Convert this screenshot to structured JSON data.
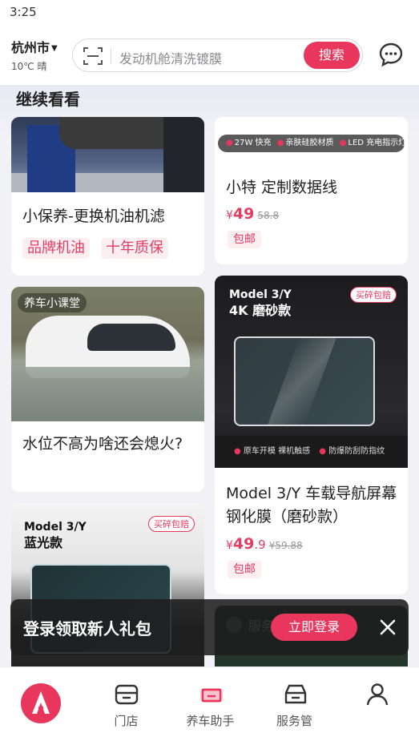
{
  "status_bar": {
    "time": "3:25"
  },
  "header": {
    "city": "杭州市",
    "weather": "10℃ 晴",
    "search": {
      "placeholder": "发动机舱清洗镀膜",
      "button": "搜索"
    }
  },
  "feed": {
    "section_title": "继续看看",
    "cards": [
      {
        "title": "小保养-更换机油机滤",
        "tags": [
          "品牌机油",
          "十年质保"
        ]
      },
      {
        "strip_items": [
          "27W 快充",
          "亲肤硅胶材质",
          "LED 充电指示灯"
        ],
        "title": "小特 定制数据线",
        "price": {
          "currency": "¥",
          "current": "49",
          "original": "58.8"
        },
        "badge": "包邮"
      },
      {
        "image_label": "养车小课堂",
        "title": "水位不高为啥还会熄火?"
      },
      {
        "image": {
          "model": "Model 3/Y",
          "variant": "4K 磨砂款",
          "corner_badge": "买碎包赔",
          "features": [
            "原车开模 裸机触感",
            "防爆防刮防指纹"
          ]
        },
        "title": "Model 3/Y 车载导航屏幕钢化膜（磨砂款）",
        "price": {
          "currency": "¥",
          "current_int": "49",
          "current_dec": ".9",
          "original": "¥59.88"
        },
        "badge": "包邮"
      },
      {
        "image": {
          "model": "Model 3/Y",
          "variant": "蓝光款",
          "corner_badge": "买碎包赔"
        }
      },
      {
        "image_label": "服务"
      }
    ]
  },
  "login_banner": {
    "text": "登录领取新人礼包",
    "button": "立即登录"
  },
  "tabbar": {
    "items": [
      {
        "label": ""
      },
      {
        "label": "门店"
      },
      {
        "label": "养车助手"
      },
      {
        "label": "服务管"
      },
      {
        "label": ""
      }
    ]
  },
  "colors": {
    "accent": "#e8365d",
    "tag_bg": "#fdeef2"
  }
}
